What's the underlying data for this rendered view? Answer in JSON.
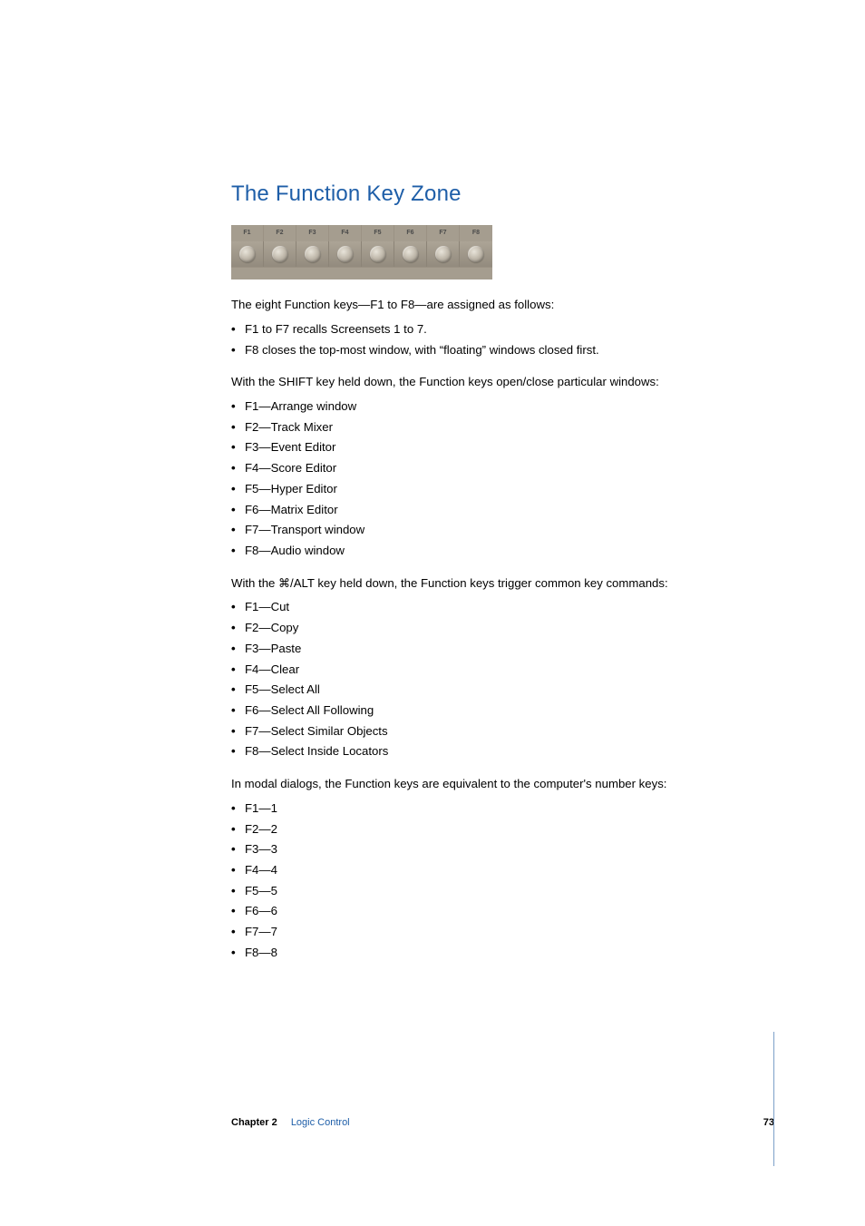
{
  "section": {
    "title": "The Function Key Zone"
  },
  "fkeys": {
    "labels": [
      "F1",
      "F2",
      "F3",
      "F4",
      "F5",
      "F6",
      "F7",
      "F8"
    ]
  },
  "intro": {
    "line1": "The eight Function keys—F1 to F8—are assigned as follows:",
    "items": [
      "F1 to F7 recalls Screensets 1 to 7.",
      "F8 closes the top-most window, with “floating” windows closed first."
    ]
  },
  "shift": {
    "lead": "With the SHIFT key held down, the Function keys open/close particular windows:",
    "items": [
      "F1—Arrange window",
      "F2—Track Mixer",
      "F3—Event Editor",
      "F4—Score Editor",
      "F5—Hyper Editor",
      "F6—Matrix Editor",
      "F7—Transport window",
      "F8—Audio window"
    ]
  },
  "cmdalt": {
    "lead_prefix": "With the ",
    "lead_suffix": "/ALT key held down, the Function keys trigger common key commands:",
    "items": [
      "F1—Cut",
      "F2—Copy",
      "F3—Paste",
      "F4—Clear",
      "F5—Select All",
      "F6—Select All Following",
      "F7—Select Similar Objects",
      "F8—Select Inside Locators"
    ]
  },
  "modal": {
    "lead": "In modal dialogs, the Function keys are equivalent to the computer's number keys:",
    "items": [
      "F1—1",
      "F2—2",
      "F3—3",
      "F4—4",
      "F5—5",
      "F6—6",
      "F7—7",
      "F8—8"
    ]
  },
  "footer": {
    "chapter_label": "Chapter 2",
    "chapter_name": "Logic Control",
    "page_number": "73"
  }
}
